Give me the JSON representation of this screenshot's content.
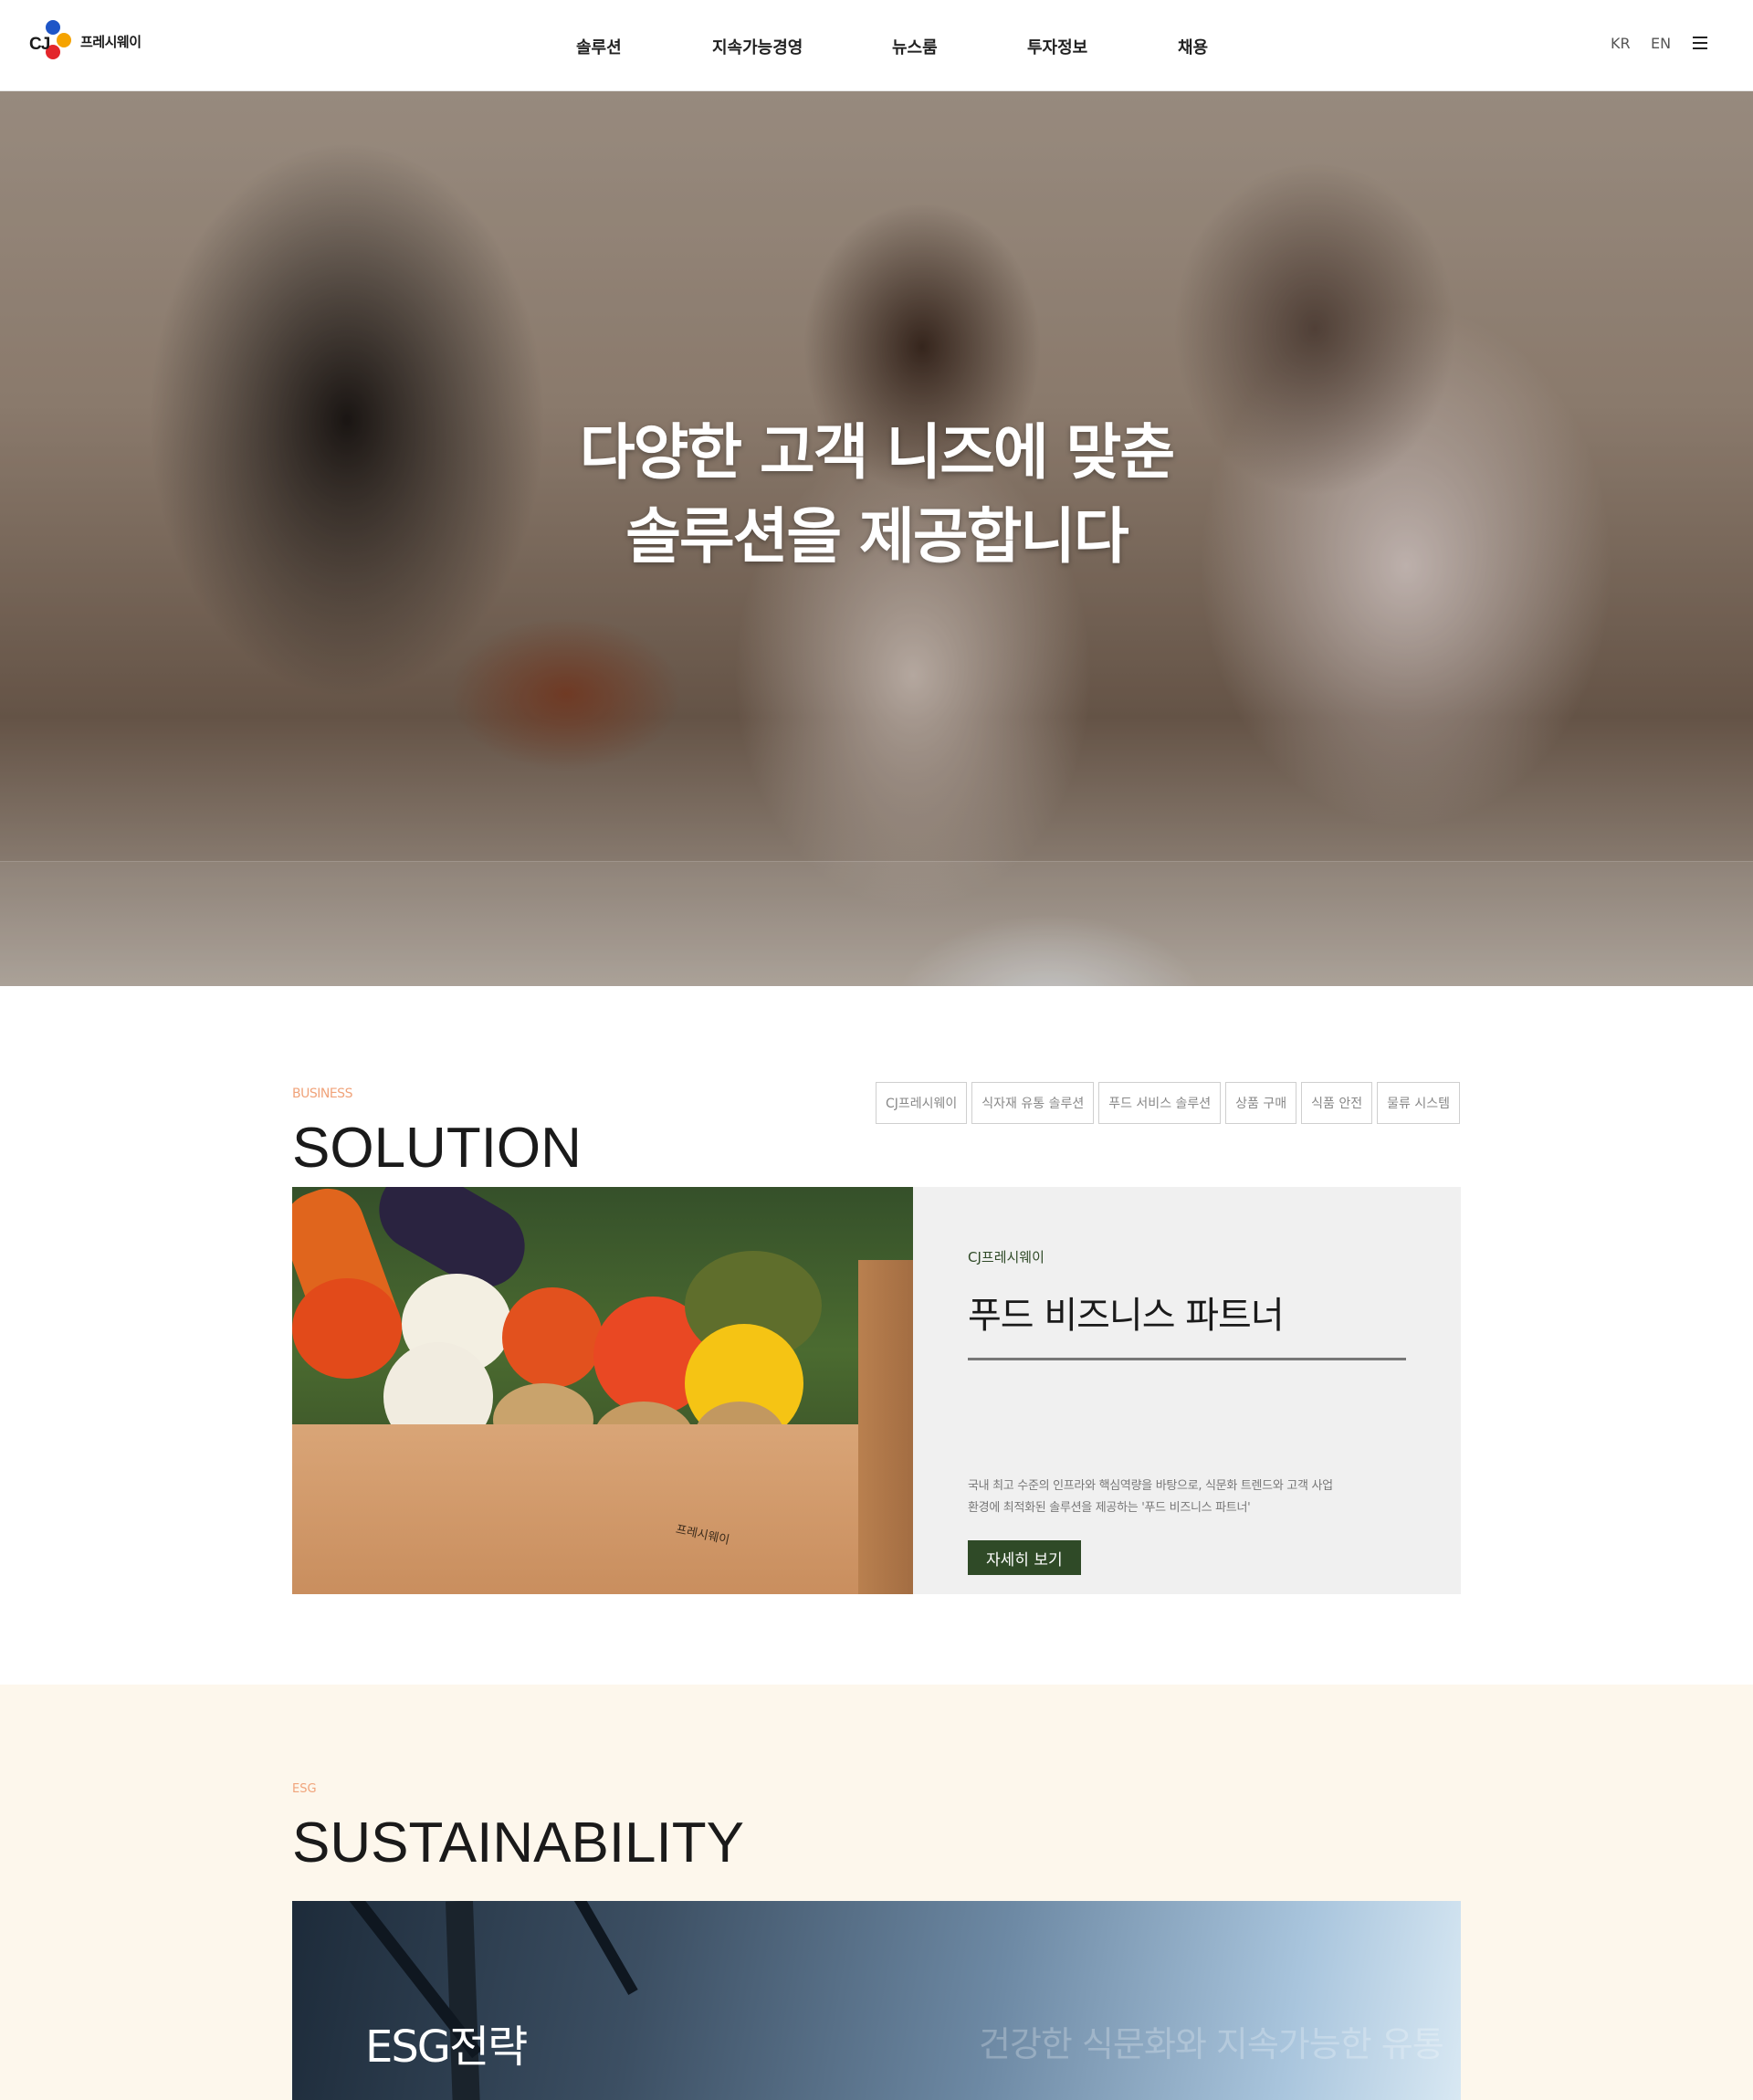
{
  "header": {
    "logo_mark": "CJ",
    "logo_text": "프레시웨이",
    "nav": [
      "솔루션",
      "지속가능경영",
      "뉴스룸",
      "투자정보",
      "채용"
    ],
    "lang_kr": "KR",
    "lang_en": "EN",
    "menu_icon": "hamburger-icon"
  },
  "hero": {
    "title_line1": "다양한 고객 니즈에 맞춘",
    "title_line2": "솔루션을 제공합니다"
  },
  "solution": {
    "label": "BUSINESS",
    "title": "SOLUTION",
    "tabs": [
      "CJ프레시웨이",
      "식자재 유통 솔루션",
      "푸드 서비스 솔루션",
      "상품 구매",
      "식품 안전",
      "물류 시스템"
    ],
    "card": {
      "brand": "CJ프레시웨이",
      "heading": "푸드 비즈니스 파트너",
      "desc_line1": "국내 최고 수준의 인프라와 핵심역량을 바탕으로, 식문화 트렌드와 고객 사업",
      "desc_line2": "환경에 최적화된 솔루션을 제공하는 '푸드 비즈니스 파트너'",
      "button": "자세히 보기",
      "box_logo": "프레시웨이"
    }
  },
  "sustainability": {
    "label": "ESG",
    "title": "SUSTAINABILITY",
    "card_title": "ESG전략",
    "card_sub": "건강한 식문화와 지속가능한 유통"
  },
  "colors": {
    "brand_green": "#2f4a27",
    "label_orange": "#f0a37a",
    "esg_bg": "#fdf7ec"
  }
}
